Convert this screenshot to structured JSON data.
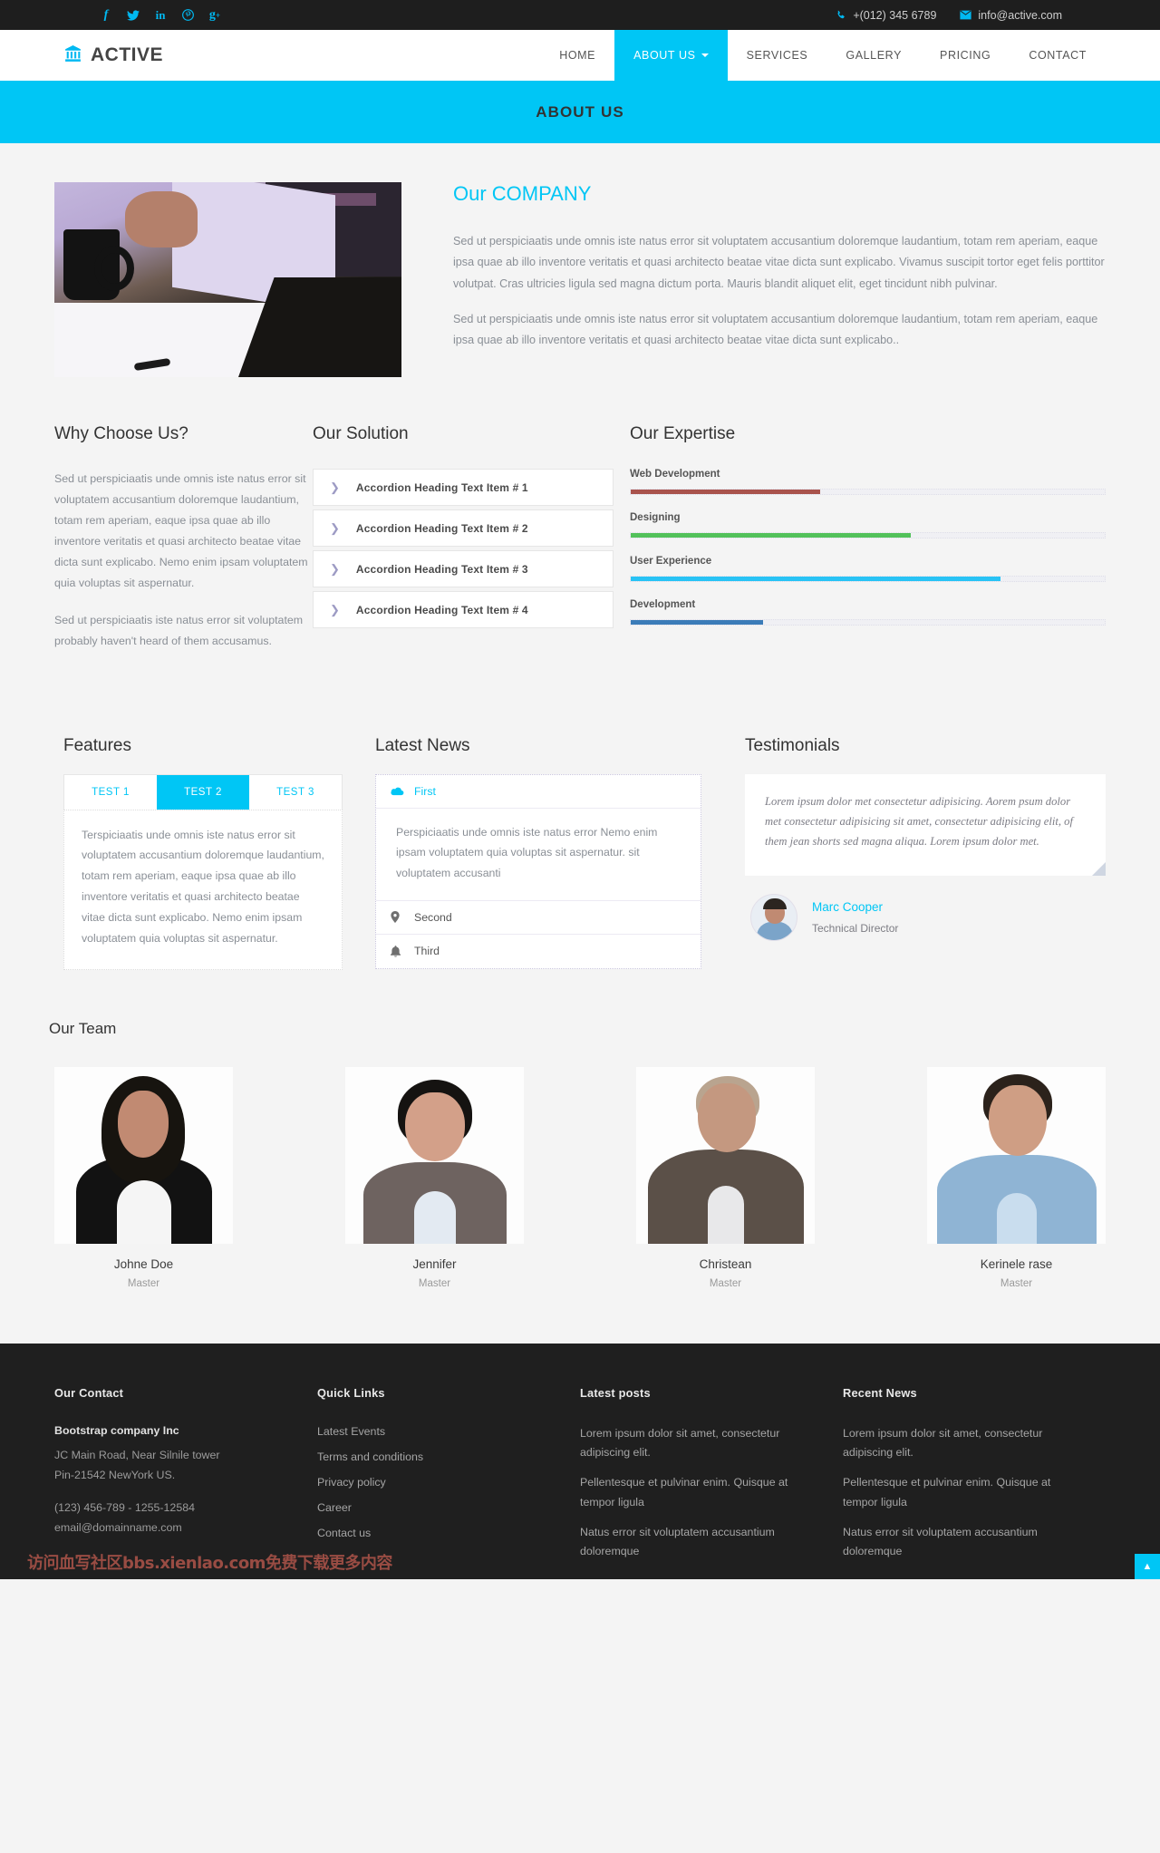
{
  "topbar": {
    "social": [
      {
        "name": "facebook",
        "glyph": "f"
      },
      {
        "name": "twitter",
        "glyph": "🐦"
      },
      {
        "name": "linkedin",
        "glyph": "in"
      },
      {
        "name": "pinterest",
        "glyph": "P"
      },
      {
        "name": "google-plus",
        "glyph": "g+"
      }
    ],
    "phone": "+(012) 345 6789",
    "email": "info@active.com"
  },
  "nav": {
    "brand": "ACTIVE",
    "items": [
      {
        "label": "HOME",
        "active": false,
        "caret": false
      },
      {
        "label": "ABOUT US",
        "active": true,
        "caret": true
      },
      {
        "label": "SERVICES",
        "active": false,
        "caret": false
      },
      {
        "label": "GALLERY",
        "active": false,
        "caret": false
      },
      {
        "label": "PRICING",
        "active": false,
        "caret": false
      },
      {
        "label": "CONTACT",
        "active": false,
        "caret": false
      }
    ]
  },
  "banner": {
    "title": "ABOUT US"
  },
  "company": {
    "heading_plain": "Our ",
    "heading_accent": "COMPANY",
    "paragraph1": "Sed ut perspiciaatis unde omnis iste natus error sit voluptatem accusantium doloremque laudantium, totam rem aperiam, eaque ipsa quae ab illo inventore veritatis et quasi architecto beatae vitae dicta sunt explicabo. Vivamus suscipit tortor eget felis porttitor volutpat. Cras ultricies ligula sed magna dictum porta. Mauris blandit aliquet elit, eget tincidunt nibh pulvinar.",
    "paragraph2": "Sed ut perspiciaatis unde omnis iste natus error sit voluptatem accusantium doloremque laudantium, totam rem aperiam, eaque ipsa quae ab illo inventore veritatis et quasi architecto beatae vitae dicta sunt explicabo.."
  },
  "why": {
    "title": "Why Choose Us?",
    "paragraph1": "Sed ut perspiciaatis unde omnis iste natus error sit voluptatem accusantium doloremque laudantium, totam rem aperiam, eaque ipsa quae ab illo inventore veritatis et quasi architecto beatae vitae dicta sunt explicabo. Nemo enim ipsam voluptatem quia voluptas sit aspernatur.",
    "paragraph2": "Sed ut perspiciaatis iste natus error sit voluptatem probably haven't heard of them accusamus."
  },
  "solution": {
    "title": "Our Solution",
    "items": [
      {
        "label": "Accordion Heading Text Item # 1"
      },
      {
        "label": "Accordion Heading Text Item # 2"
      },
      {
        "label": "Accordion Heading Text Item # 3"
      },
      {
        "label": "Accordion Heading Text Item # 4"
      }
    ]
  },
  "expertise": {
    "title": "Our Expertise",
    "skills": [
      {
        "name": "Web Development",
        "percent": 40,
        "color": "#a9534c"
      },
      {
        "name": "Designing",
        "percent": 59,
        "color": "#52c15a"
      },
      {
        "name": "User Experience",
        "percent": 78,
        "color": "#28c3f5"
      },
      {
        "name": "Development",
        "percent": 28,
        "color": "#3b7cb8"
      }
    ]
  },
  "features": {
    "title": "Features",
    "tabs": [
      {
        "label": "TEST 1",
        "active": false
      },
      {
        "label": "TEST 2",
        "active": true
      },
      {
        "label": "TEST 3",
        "active": false
      }
    ],
    "body": "Terspiciaatis unde omnis iste natus error sit voluptatem accusantium doloremque laudantium, totam rem aperiam, eaque ipsa quae ab illo inventore veritatis et quasi architecto beatae vitae dicta sunt explicabo. Nemo enim ipsam voluptatem quia voluptas sit aspernatur."
  },
  "latest_news": {
    "title": "Latest News",
    "first_label": "First",
    "first_icon": "cloud-icon",
    "first_body": "Perspiciaatis unde omnis iste natus error Nemo enim ipsam voluptatem quia voluptas sit aspernatur. sit voluptatem accusanti",
    "rows": [
      {
        "label": "Second",
        "icon": "map-pin-icon"
      },
      {
        "label": "Third",
        "icon": "bell-icon"
      }
    ]
  },
  "testimonials": {
    "title": "Testimonials",
    "quote": "Lorem ipsum dolor met consectetur adipisicing. Aorem psum dolor met consectetur adipisicing sit amet, consectetur adipisicing elit, of them jean shorts sed magna aliqua. Lorem ipsum dolor met.",
    "author_name": "Marc Cooper",
    "author_role": "Technical Director"
  },
  "team": {
    "title": "Our Team",
    "members": [
      {
        "name": "Johne Doe",
        "role": "Master",
        "hair": "#17140f",
        "skin": "#c18a72",
        "cloth": "#121212"
      },
      {
        "name": "Jennifer",
        "role": "Master",
        "hair": "#151311",
        "skin": "#d3a089",
        "cloth": "#6e6360"
      },
      {
        "name": "Christean",
        "role": "Master",
        "hair": "#b9a48f",
        "skin": "#c49880",
        "cloth": "#5b5048"
      },
      {
        "name": "Kerinele rase",
        "role": "Master",
        "hair": "#2b221b",
        "skin": "#cf9e84",
        "cloth": "#8fb4d4"
      }
    ]
  },
  "footer": {
    "contact": {
      "title": "Our Contact",
      "company": "Bootstrap company Inc",
      "address1": "JC Main Road, Near Silnile tower",
      "address2": "Pin-21542 NewYork US.",
      "phone": "(123) 456-789 - 1255-12584",
      "email": "email@domainname.com"
    },
    "quick_links": {
      "title": "Quick Links",
      "items": [
        "Latest Events",
        "Terms and conditions",
        "Privacy policy",
        "Career",
        "Contact us"
      ]
    },
    "latest_posts": {
      "title": "Latest posts",
      "items": [
        "Lorem ipsum dolor sit amet, consectetur adipiscing elit.",
        "Pellentesque et pulvinar enim. Quisque at tempor ligula",
        "Natus error sit voluptatem accusantium doloremque"
      ]
    },
    "recent_news": {
      "title": "Recent News",
      "items": [
        "Lorem ipsum dolor sit amet, consectetur adipiscing elit.",
        "Pellentesque et pulvinar enim. Quisque at tempor ligula",
        "Natus error sit voluptatem accusantium doloremque"
      ]
    },
    "watermark": "访问血写社区bbs.xienlao.com免费下载更多内容",
    "to_top": "▲"
  },
  "colors": {
    "accent": "#00c6f5",
    "dark": "#1f1f1f"
  }
}
